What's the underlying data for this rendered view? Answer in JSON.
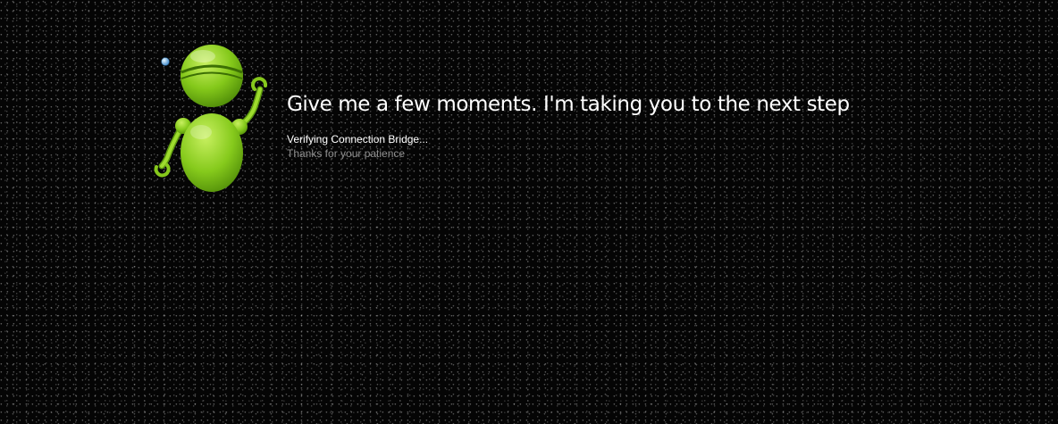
{
  "page": {
    "headline": "Give me a few moments. I'm taking you to the next step",
    "status": "Verifying Connection Bridge...",
    "subtext": "Thanks for your patience"
  },
  "colors": {
    "background": "#050505",
    "robot_green": "#8ccf1c",
    "subtext": "#8f8f8f"
  },
  "icons": {
    "mascot": "green-robot-waving-icon",
    "bubble": "blue-bubble-icon"
  }
}
